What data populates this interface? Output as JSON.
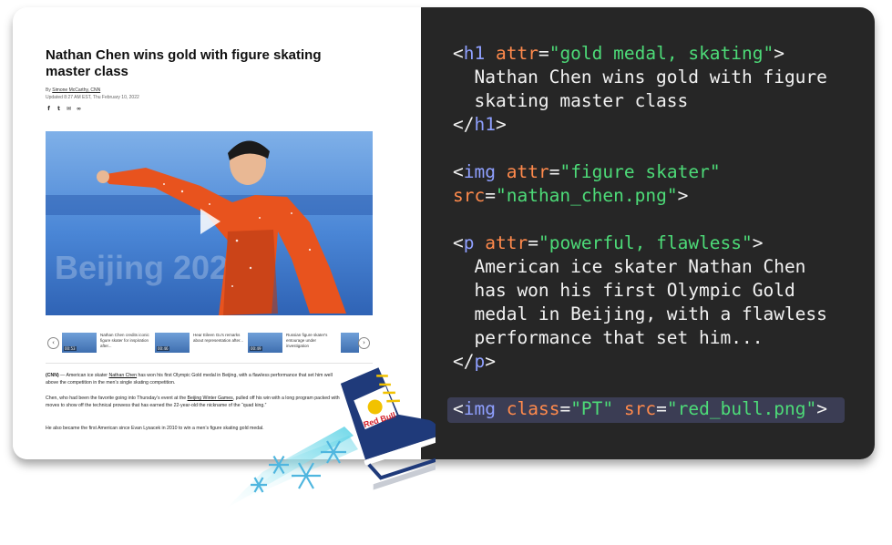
{
  "article": {
    "title": "Nathan Chen wins gold with figure skating master class",
    "byline_prefix": "By ",
    "author": "Simone McCarthy, CNN",
    "updated": "Updated 8:27 AM EST, Thu February 10, 2022",
    "social_icons": [
      "facebook-icon",
      "twitter-icon",
      "email-icon",
      "link-icon"
    ],
    "hero_image_text": "Beijing 2022",
    "carousel": [
      {
        "text": "Nathan Chen credits iconic figure skater for inspiration after...",
        "duration": "00:53"
      },
      {
        "text": "Hear Eileen Gu's remarks about representation after...",
        "duration": "00:46"
      },
      {
        "text": "Russian figure skater's entourage under investigation",
        "duration": "00:49"
      }
    ],
    "p1_source": "(CNN)",
    "p1_a": " — American ice skater ",
    "p1_link": "Nathan Chen",
    "p1_b": " has won his first Olympic Gold medal in Beijing, with a flawless performance that set him well above the competition in the men’s single skating competition.",
    "p2_a": "Chen, who had been the favorite going into Thursday’s event at the ",
    "p2_link": "Beijing Winter Games",
    "p2_b": ", pulled off his win with a long program packed with moves to show off the technical prowess that has earned the 22-year-old the nickname of the “quad king.”",
    "p3": "He also became the first American since Evan Lysacek in 2010 to win a men’s figure skating gold medal."
  },
  "code": {
    "h1_open": [
      "<",
      "h1",
      " ",
      "attr",
      "=",
      "\"gold medal, skating\"",
      ">"
    ],
    "h1_text_1": "  Nathan Chen wins gold with figure",
    "h1_text_2": "  skating master class",
    "h1_close": [
      "</",
      "h1",
      ">"
    ],
    "img_open_1": [
      "<",
      "img",
      " ",
      "attr",
      "=",
      "\"figure skater\""
    ],
    "img_open_2": [
      "src",
      "=",
      "\"nathan_chen.png\"",
      ">"
    ],
    "p_open": [
      "<",
      "p",
      " ",
      "attr",
      "=",
      "\"powerful, flawless\"",
      ">"
    ],
    "p_text_1": "  American ice skater Nathan Chen",
    "p_text_2": "  has won his first Olympic Gold",
    "p_text_3": "  medal in Beijing, with a flawless",
    "p_text_4": "  performance that set him...",
    "p_close": [
      "</",
      "p",
      ">"
    ],
    "pt_line": [
      "<",
      "img",
      " ",
      "class",
      "=",
      "\"PT\"",
      " ",
      "src",
      "=",
      "\"red_bull.png\"",
      ">"
    ]
  },
  "skate": {
    "brand": "Red Bull",
    "colors": {
      "boot": "#1f3a7a",
      "blade": "#c8ccd4",
      "laces": "#f2c200",
      "logo": "#d4202a"
    }
  },
  "colors": {
    "code_bg": "#262626",
    "tag": "#8fa0ff",
    "attribute": "#ff8a4c",
    "string": "#4ddb78",
    "highlight": "#3b3d54"
  }
}
